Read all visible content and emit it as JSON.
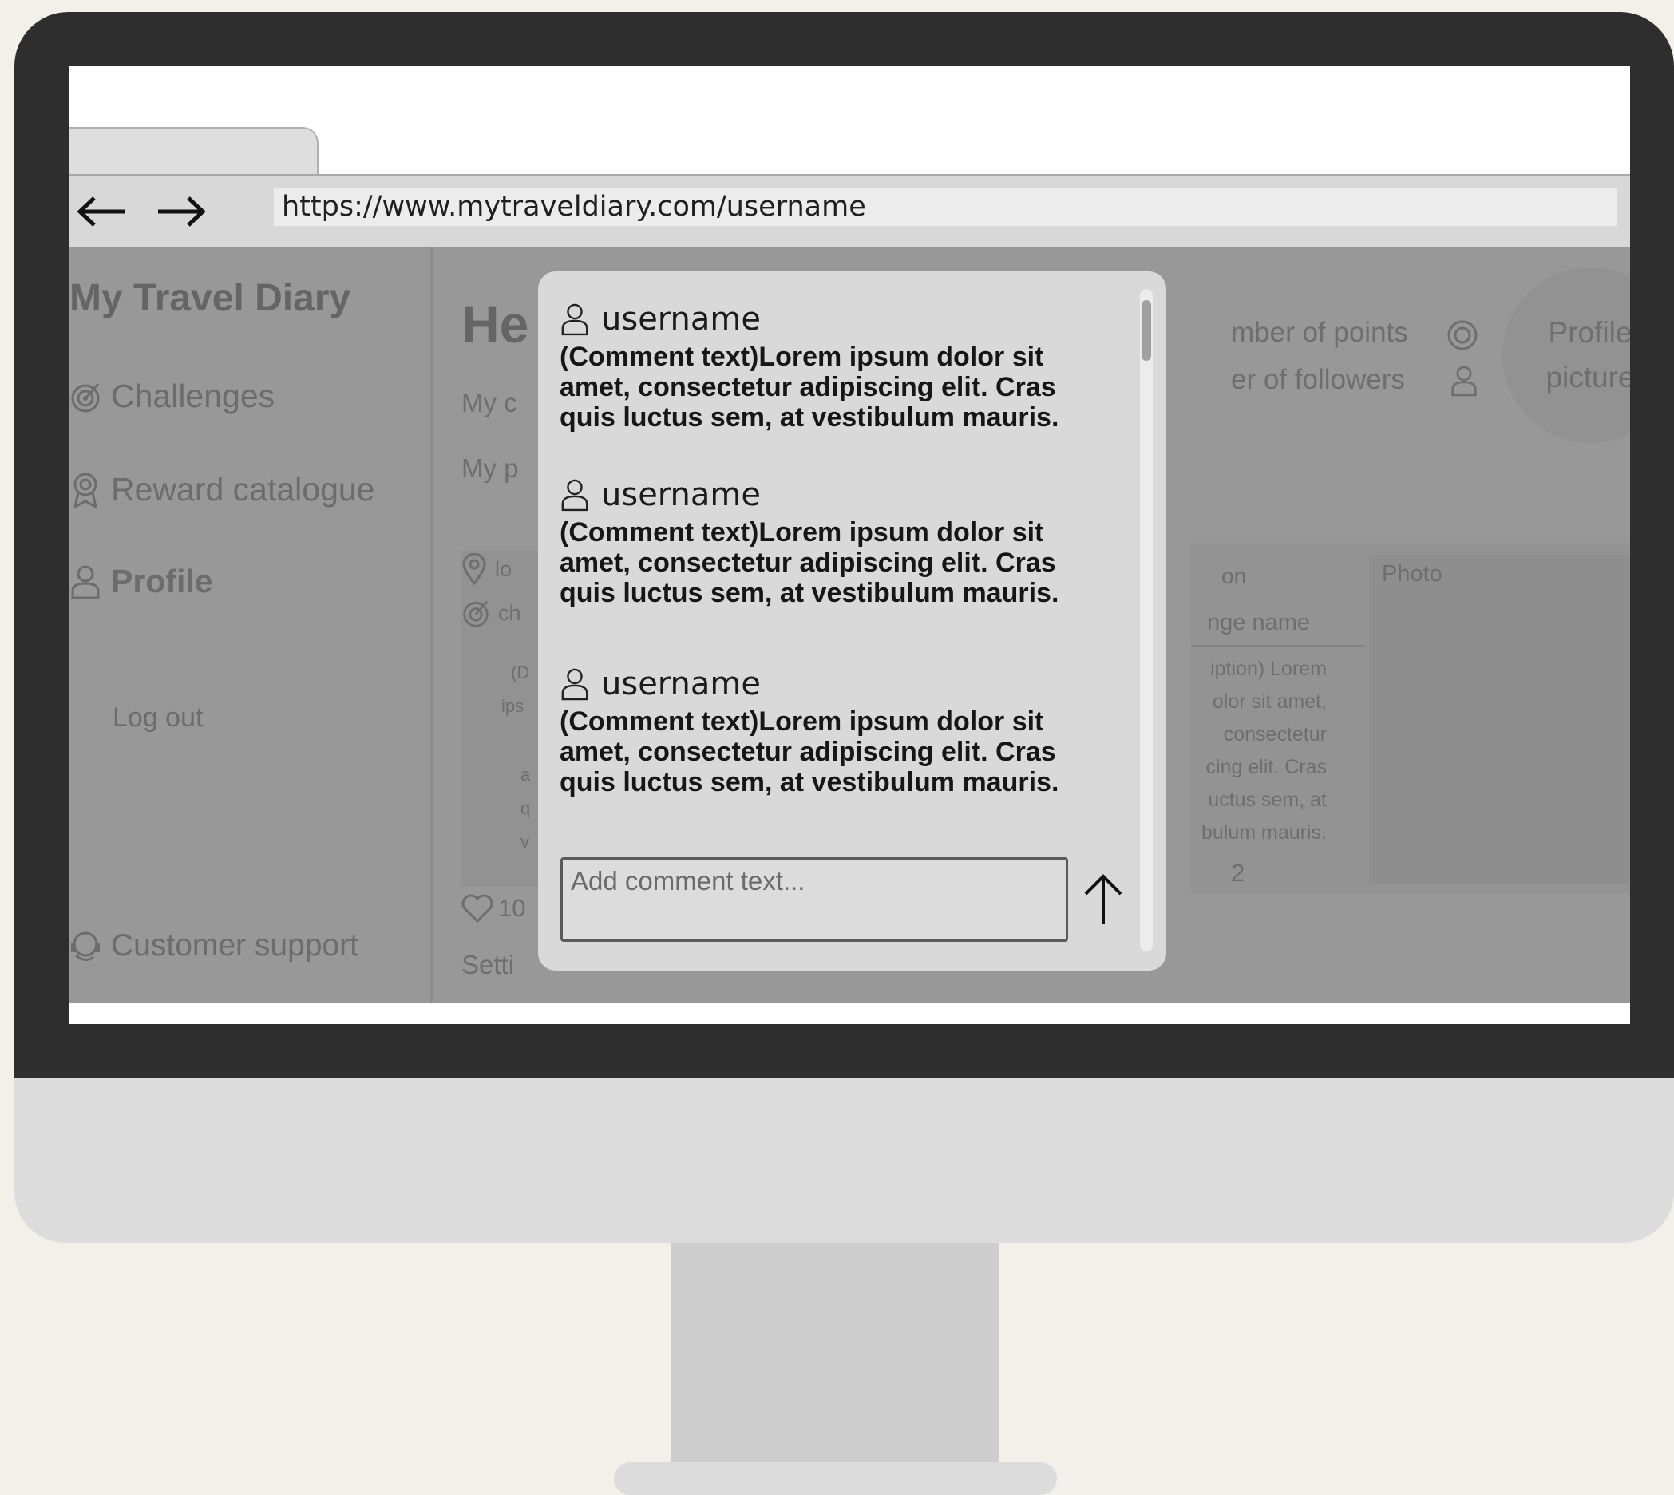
{
  "browser": {
    "url": "https://www.mytraveldiary.com/username"
  },
  "sidebar": {
    "brand": "My Travel Diary",
    "items": [
      {
        "label": "Challenges",
        "icon": "target-icon"
      },
      {
        "label": "Reward catalogue",
        "icon": "award-icon"
      },
      {
        "label": "Profile",
        "icon": "user-icon"
      }
    ],
    "logout": "Log out",
    "support": "Customer support"
  },
  "profile": {
    "heading": "He",
    "my_c": "My c",
    "my_p": "My p",
    "loc": "lo",
    "ch": "ch",
    "likes": "10",
    "settings": "Setti",
    "points_label": "mber of points",
    "followers_label": "er of followers",
    "profile_picture": "Profile picture"
  },
  "post": {
    "col_header": "on",
    "challenge_name": "nge name",
    "description_lines": [
      "iption) Lorem",
      "olor sit amet,",
      "consectetur",
      "cing elit. Cras",
      "uctus sem, at",
      "bulum mauris."
    ],
    "comment_count": "2",
    "photo_label": "Photo"
  },
  "feed_fragments": {
    "d": "(D",
    "ips": "ips",
    "a": "a",
    "q": "q",
    "v": "v"
  },
  "comments_modal": {
    "comments": [
      {
        "username": "username",
        "text": "(Comment text)Lorem ipsum dolor sit amet, consectetur adipiscing elit. Cras quis  luctus sem, at vestibulum mauris."
      },
      {
        "username": "username",
        "text": "(Comment text)Lorem ipsum dolor sit amet, consectetur adipiscing elit. Cras quis  luctus sem, at vestibulum mauris."
      },
      {
        "username": "username",
        "text": "(Comment text)Lorem ipsum dolor sit amet, consectetur adipiscing elit. Cras quis  luctus sem, at vestibulum mauris."
      }
    ],
    "input": {
      "placeholder": "Add comment text...",
      "value": ""
    }
  }
}
